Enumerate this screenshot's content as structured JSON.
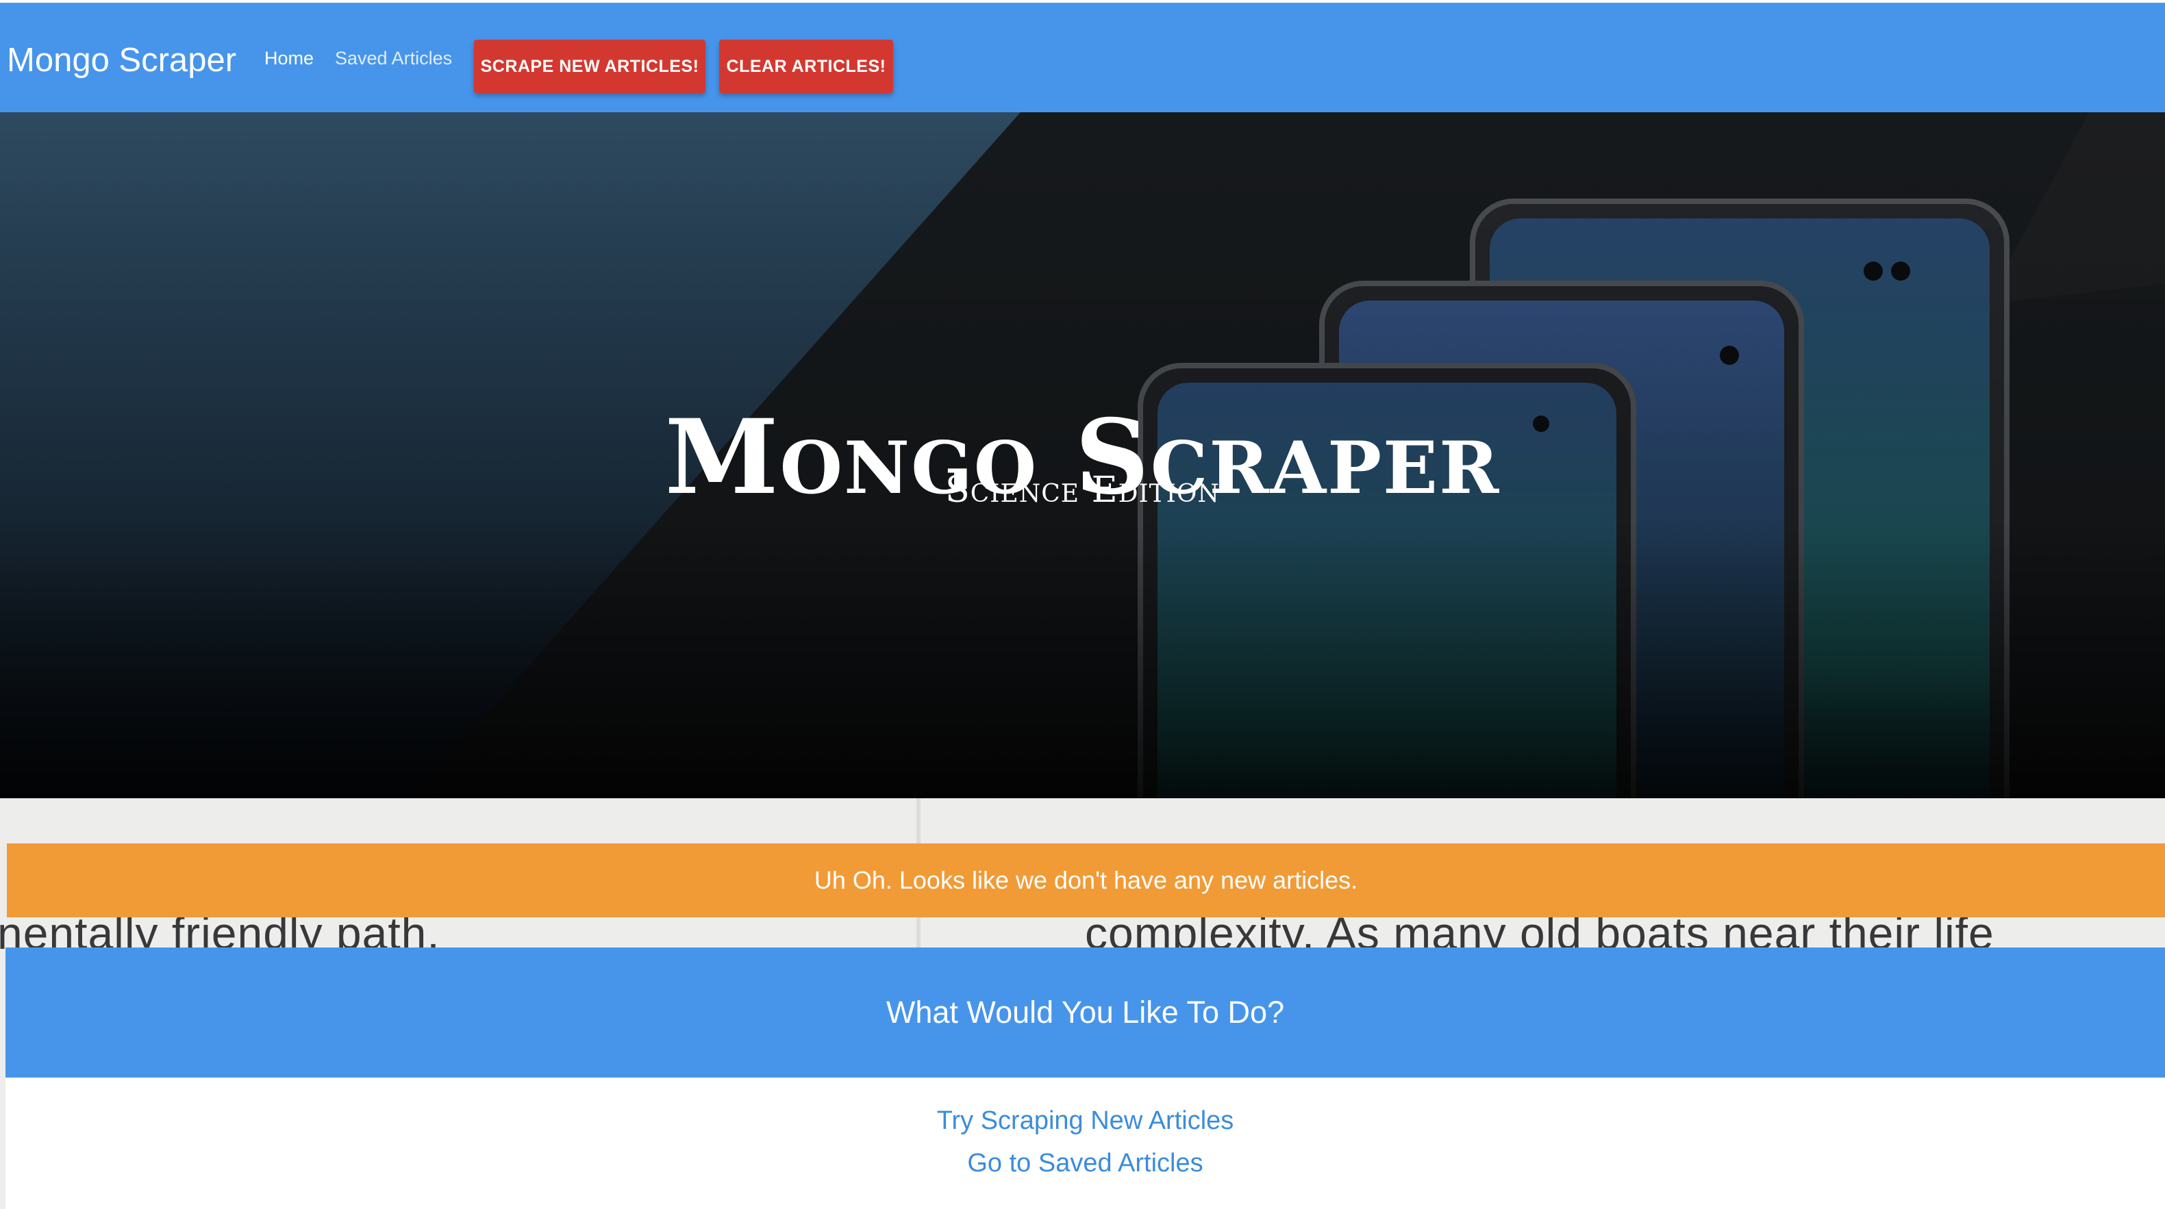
{
  "navbar": {
    "brand": "Mongo Scraper",
    "links": [
      "Home",
      "Saved Articles"
    ],
    "scrape_button": "SCRAPE NEW ARTICLES!",
    "clear_button": "CLEAR ARTICLES!",
    "color": "#4795eb"
  },
  "hero": {
    "title": "Mongo Scraper",
    "subtitle": "Science Edition"
  },
  "alert": {
    "message": "Uh Oh. Looks like we don't have any new articles.",
    "color": "#f19b37"
  },
  "action_card": {
    "heading": "What Would You Like To Do?",
    "links": [
      "Try Scraping New Articles",
      "Go to Saved Articles"
    ]
  },
  "background_text": {
    "left_line": "nentally friendly path.",
    "right_line": "complexity. As many old boats near their life"
  },
  "colors": {
    "button_red": "#d33830",
    "link_blue": "#3b8cdc"
  }
}
